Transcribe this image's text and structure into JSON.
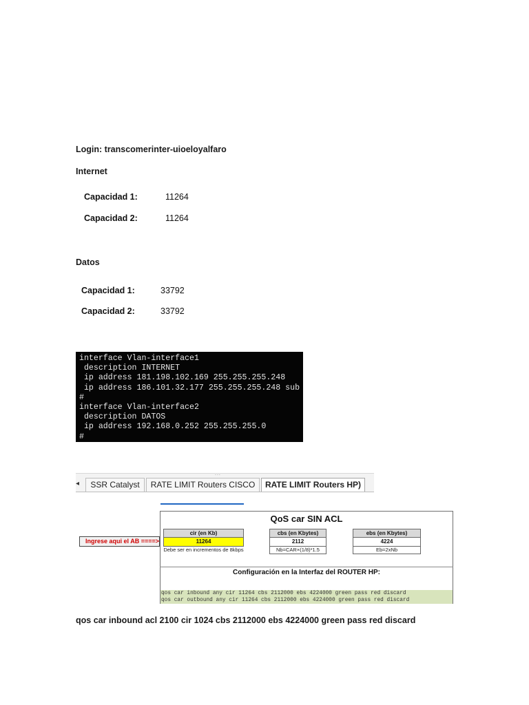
{
  "login": "Login: transcomerinter-uioeloyalfaro",
  "internet": {
    "heading": "Internet",
    "capacities": [
      {
        "label": "Capacidad 1:",
        "value": "11264"
      },
      {
        "label": "Capacidad 2:",
        "value": "11264"
      }
    ]
  },
  "datos": {
    "heading": "Datos",
    "capacities": [
      {
        "label": "Capacidad 1:",
        "value": "33792"
      },
      {
        "label": "Capacidad 2:",
        "value": "33792"
      }
    ]
  },
  "terminal": {
    "lines": [
      "interface Vlan-interface1",
      " description INTERNET",
      " ip address 181.198.102.169 255.255.255.248",
      " ip address 186.101.32.177 255.255.255.248 sub",
      "#",
      "interface Vlan-interface2",
      " description DATOS",
      " ip address 192.168.0.252 255.255.255.0",
      "#"
    ]
  },
  "tabs": {
    "grip": "...",
    "arrow": "◂",
    "items": [
      "SSR Catalyst",
      "RATE LIMIT Routers CISCO",
      "RATE LIMIT Routers HP)"
    ],
    "active_index": 2
  },
  "qos": {
    "title": "QoS car SIN ACL",
    "input_label": "Ingrese aqui el AB ====>",
    "fields": [
      {
        "header": "cir (en Kb)",
        "value": "11264",
        "note": "Debe ser en incrementos de 8kbps"
      },
      {
        "header": "cbs (en Kbytes)",
        "value": "2112",
        "note": "Nb=CAR×(1/8)*1.5"
      },
      {
        "header": "ebs (en Kbytes)",
        "value": "4224",
        "note": "Eb=2xNb"
      }
    ],
    "config_title": "Configuración en la Interfaz del ROUTER HP:",
    "commands": [
      "qos car inbound any cir 11264 cbs 2112000 ebs 4224000 green pass red discard",
      "qos car outbound any cir 11264 cbs 2112000 ebs 4224000 green pass red discard"
    ],
    "colors": {
      "highlight": "#ffff00",
      "command_bg": "#d8e4bc",
      "ingrese_text": "#d00000"
    }
  },
  "bottom_command": "qos car inbound acl 2100 cir 1024 cbs 2112000 ebs 4224000 green pass red discard"
}
